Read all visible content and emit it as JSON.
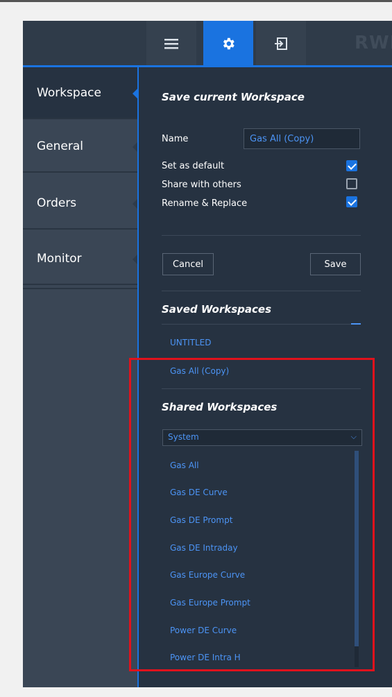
{
  "brand": "RWI",
  "sidebar": {
    "items": [
      {
        "label": "Workspace"
      },
      {
        "label": "General"
      },
      {
        "label": "Orders"
      },
      {
        "label": "Monitor"
      }
    ]
  },
  "save_section": {
    "title": "Save current Workspace",
    "name_label": "Name",
    "name_value": "Gas All (Copy)",
    "options": [
      {
        "label": "Set as default",
        "checked": true
      },
      {
        "label": "Share with others",
        "checked": false
      },
      {
        "label": "Rename & Replace",
        "checked": true
      }
    ],
    "cancel_label": "Cancel",
    "save_label": "Save"
  },
  "saved_section": {
    "title": "Saved Workspaces",
    "items": [
      {
        "label": "UNTITLED"
      },
      {
        "label": "Gas All (Copy)"
      }
    ]
  },
  "shared_section": {
    "title": "Shared Workspaces",
    "filter_value": "System",
    "items": [
      {
        "label": "Gas All"
      },
      {
        "label": "Gas DE Curve"
      },
      {
        "label": "Gas DE Prompt"
      },
      {
        "label": "Gas DE Intraday"
      },
      {
        "label": "Gas Europe Curve"
      },
      {
        "label": "Gas Europe Prompt"
      },
      {
        "label": "Power DE Curve"
      },
      {
        "label": "Power DE Intra H"
      }
    ]
  },
  "colors": {
    "accent": "#1a73e0",
    "link": "#4c94f5",
    "highlight": "#e0121c"
  }
}
